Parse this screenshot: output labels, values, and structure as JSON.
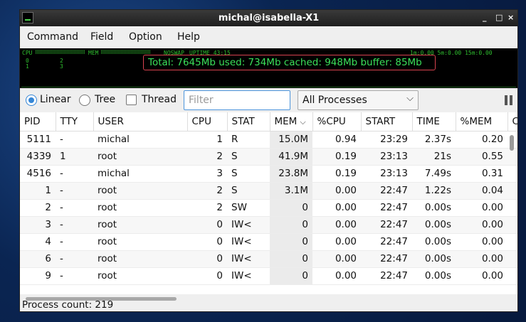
{
  "window": {
    "title": "michal@isabella-X1",
    "controls": [
      "_",
      "□",
      "×"
    ]
  },
  "menu": [
    "Command",
    "Field",
    "Option",
    "Help"
  ],
  "graph": {
    "cpu_label": "CPU",
    "mem_label": "MEM",
    "noswap": "NOSWAP",
    "uptime": "UPTIME 43:15",
    "load": "1m:0.00 5m:0.00 15m:0.00",
    "cpu0": "0",
    "cpu1": "1",
    "cpu2": "2",
    "cpu3": "3",
    "mem_text": "Total: 7645Mb  used: 734Mb  cached: 948Mb  buffer: 85Mb"
  },
  "toolbar": {
    "linear_label": "Linear",
    "tree_label": "Tree",
    "thread_label": "Thread",
    "filter_placeholder": "Filter",
    "process_filter": "All Processes"
  },
  "table": {
    "columns": [
      "PID",
      "TTY",
      "USER",
      "CPU",
      "STAT",
      "MEM",
      "%CPU",
      "START",
      "TIME",
      "%MEM",
      "C"
    ],
    "rows": [
      [
        "5111",
        "-",
        "michal",
        "1",
        "R",
        "15.0M",
        "0.94",
        "23:29",
        "2.37s",
        "0.20"
      ],
      [
        "4339",
        "1",
        "root",
        "2",
        "S",
        "41.9M",
        "0.19",
        "23:13",
        "21s",
        "0.55"
      ],
      [
        "4516",
        "-",
        "michal",
        "3",
        "S",
        "23.8M",
        "0.19",
        "23:13",
        "7.49s",
        "0.31"
      ],
      [
        "1",
        "-",
        "root",
        "2",
        "S",
        "3.1M",
        "0.00",
        "22:47",
        "1.22s",
        "0.04"
      ],
      [
        "2",
        "-",
        "root",
        "2",
        "SW",
        "0",
        "0.00",
        "22:47",
        "0.00s",
        "0.00"
      ],
      [
        "3",
        "-",
        "root",
        "0",
        "IW<",
        "0",
        "0.00",
        "22:47",
        "0.00s",
        "0.00"
      ],
      [
        "4",
        "-",
        "root",
        "0",
        "IW<",
        "0",
        "0.00",
        "22:47",
        "0.00s",
        "0.00"
      ],
      [
        "6",
        "-",
        "root",
        "0",
        "IW<",
        "0",
        "0.00",
        "22:47",
        "0.00s",
        "0.00"
      ],
      [
        "9",
        "-",
        "root",
        "0",
        "IW<",
        "0",
        "0.00",
        "22:47",
        "0.00s",
        "0.00"
      ]
    ]
  },
  "status": "Process count: 219"
}
